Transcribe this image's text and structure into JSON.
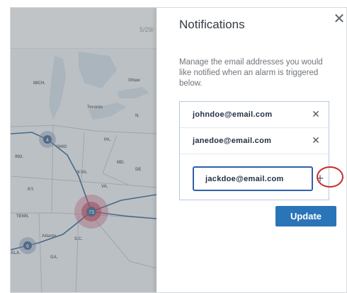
{
  "background": {
    "date_fragment": "5/29/",
    "map_labels": [
      "MICH.",
      "Ottaw",
      "Toronto",
      "N.",
      "OHIO",
      "PA.",
      "IND.",
      "MD.",
      "DE",
      "W.VA.",
      "VA.",
      "KY.",
      "TENN.",
      "S.C.",
      "Atlanta",
      "GA.",
      "ALA."
    ],
    "clusters": [
      {
        "label": "4"
      },
      {
        "label": "73"
      },
      {
        "label": "6"
      }
    ]
  },
  "panel": {
    "title": "Notifications",
    "close_icon": "close-icon",
    "description": "Manage the email addresses you would like notified when an alarm is triggered below.",
    "emails": [
      {
        "address": "johndoe@email.com"
      },
      {
        "address": "janedoe@email.com"
      }
    ],
    "new_email_value": "jackdoe@email.com",
    "add_icon": "plus-icon",
    "update_label": "Update",
    "accent_color": "#2a74b8",
    "highlight_color": "#cc2a2a"
  }
}
